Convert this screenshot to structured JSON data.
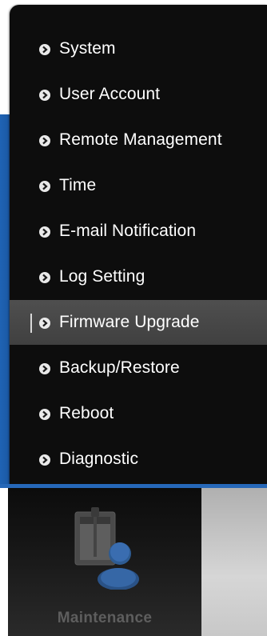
{
  "menu": {
    "items": [
      {
        "label": "System"
      },
      {
        "label": "User Account"
      },
      {
        "label": "Remote Management"
      },
      {
        "label": "Time"
      },
      {
        "label": "E-mail Notification"
      },
      {
        "label": "Log Setting"
      },
      {
        "label": "Firmware Upgrade",
        "active": true
      },
      {
        "label": "Backup/Restore"
      },
      {
        "label": "Reboot"
      },
      {
        "label": "Diagnostic"
      }
    ]
  },
  "bottom_tabs": {
    "maintenance": {
      "label": "Maintenance",
      "icon": "maintenance-icon"
    }
  },
  "colors": {
    "accent_blue": "#2668b8",
    "menu_background": "#0d0d0d",
    "active_item": "#4a4a4a"
  }
}
